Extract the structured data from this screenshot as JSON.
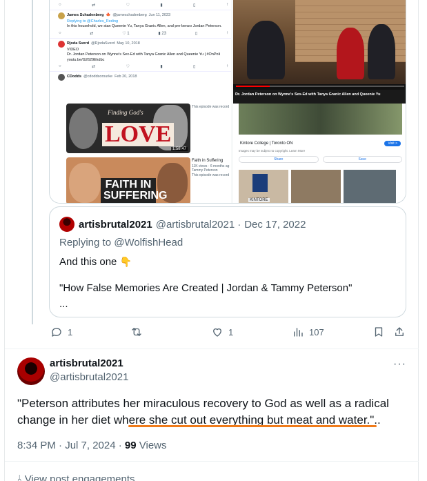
{
  "media": {
    "embedded_tweets": [
      {
        "name": "James Schadenberg",
        "flag": "🍁",
        "handle": "@jameschadenberg",
        "date": "Jun 11, 2023",
        "replying_to": "Replying to @Charles_Reding",
        "body": "In this household, we stan Queenie Yu, Tanya Granic Allen, and pre-benzo Jordan Peterson.",
        "stats": {
          "retweets": "",
          "likes": "1",
          "views": "23"
        }
      },
      {
        "name": "Rjoda Sverd",
        "handle": "@RjodaSverd",
        "date": "May 10, 2018",
        "label": "VIDEO",
        "body": "Dr. Jordan Peterson on Wynne's Sex-Ed with Tanya Granic Allen and Queenie Yu | #OnPoli youtu.be/G2629Ekdbc"
      },
      {
        "name": "CDodds",
        "handle": "@cdoddsorourke",
        "date": "Feb 20, 2018"
      }
    ],
    "video": {
      "time": "1:56 / 4:06",
      "caption": "Dr. Jordan Peterson on Wynne's Sex-Ed with Tanya Granic Allen and Queenie Yu"
    },
    "podcasts": [
      {
        "title_art": "LOVE",
        "overlay": "Finding God's",
        "duration": "1:58:47",
        "meta": "This episode was record"
      },
      {
        "title_art": "FAITH IN SUFFERING",
        "meta_title": "Faith in Suffering",
        "meta_views": "11K views · 6 months ag",
        "meta_author": "Tammy Peterson",
        "meta": "This episode was record"
      }
    ],
    "place_card": {
      "title": "Kintore College | Toronto ON",
      "subtitle": "Images may be subject to copyright. Learn More",
      "visit": "Visit >",
      "share": "Share",
      "save": "Save",
      "sign_text": "KINTORE"
    }
  },
  "quote": {
    "name": "artisbrutal2021",
    "handle": "@artisbrutal2021",
    "date": "Dec 17, 2022",
    "replying_to": "Replying to @WolfishHead",
    "text_line1": "And this one",
    "emoji": "👇",
    "text_line2": "\"How False Memories Are Created | Jordan & Tammy Peterson\"",
    "text_line3": "..."
  },
  "actions": {
    "replies": "1",
    "retweets": "",
    "likes": "1",
    "views": "107"
  },
  "main": {
    "name": "artisbrutal2021",
    "handle": "@artisbrutal2021",
    "more": "···",
    "text": "\"Peterson attributes her miraculous recovery to God as well as a radical change in her diet where she cut out everything but meat and water.\"..",
    "time": "8:34 PM · Jul 7, 2024 · ",
    "views_count": "99",
    "views_label": " Views",
    "view_engagements": "View post engagements"
  },
  "colors": {
    "highlight_underline": "#f07b1a",
    "link": "#1d9bf0",
    "secondary_text": "#536471"
  }
}
